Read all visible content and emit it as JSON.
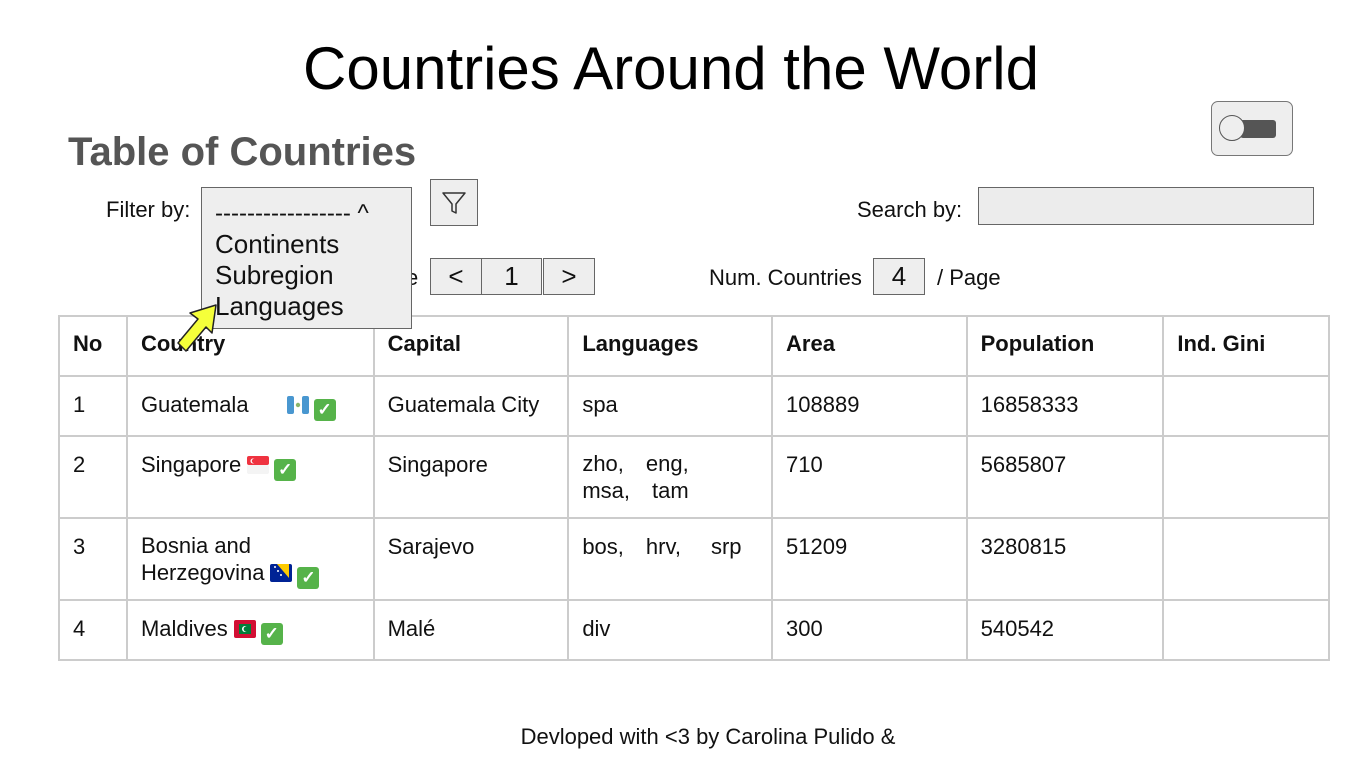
{
  "title": "Countries Around the World",
  "subtitle": "Table of Countries",
  "filter": {
    "label": "Filter by:",
    "selected": "----------------- ^",
    "options": [
      "Continents",
      "Subregion",
      "Languages"
    ]
  },
  "search": {
    "label": "Search by:",
    "value": ""
  },
  "pagination": {
    "label": "e",
    "prev": "<",
    "page": "1",
    "next": ">",
    "num_label": "Num. Countries",
    "num_value": "4",
    "per_page": "/ Page"
  },
  "table": {
    "headers": [
      "No",
      "Country",
      "Capital",
      "Languages",
      "Area",
      "Population",
      "Ind. Gini"
    ],
    "rows": [
      {
        "no": "1",
        "country": "Guatemala",
        "capital": "Guatemala City",
        "languages": [
          "spa"
        ],
        "area": "108889",
        "population": "16858333",
        "gini": ""
      },
      {
        "no": "2",
        "country": "Singapore",
        "capital": "Singapore",
        "languages": [
          "zho,",
          "eng,",
          "msa,",
          "tam"
        ],
        "area": "710",
        "population": "5685807",
        "gini": ""
      },
      {
        "no": "3",
        "country": "Bosnia and Herzegovina",
        "capital": "Sarajevo",
        "languages": [
          "bos,",
          "hrv,",
          "srp"
        ],
        "area": "51209",
        "population": "3280815",
        "gini": ""
      },
      {
        "no": "4",
        "country": "Maldives",
        "capital": "Malé",
        "languages": [
          "div"
        ],
        "area": "300",
        "population": "540542",
        "gini": ""
      }
    ]
  },
  "footer": "Devloped with <3 by Carolina Pulido &",
  "colors": {
    "subtitle": "#555555",
    "check": "#56b34a",
    "cursor": "#f5ff3a"
  }
}
